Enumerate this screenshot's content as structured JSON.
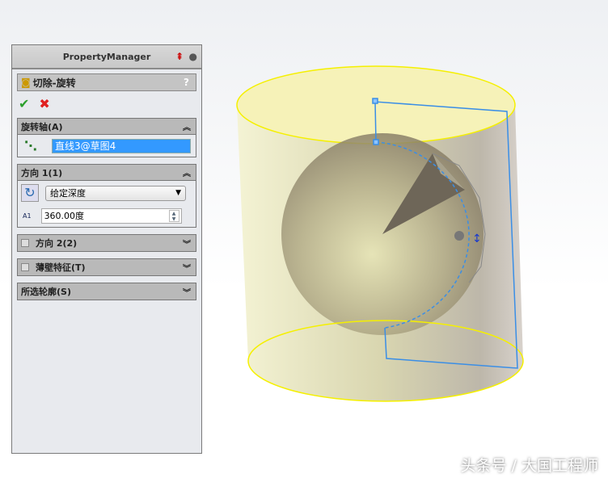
{
  "property_manager": {
    "title": "PropertyManager",
    "feature_name": "切除-旋转",
    "help": "?",
    "ok": "✔",
    "cancel": "✖",
    "axis_group": {
      "title": "旋转轴(A)",
      "value": "直线3@草图4"
    },
    "direction1": {
      "title": "方向 1(1)",
      "end_condition": "给定深度",
      "angle": "360.00度",
      "angle_icon_label": "A1"
    },
    "direction2": {
      "title": "方向 2(2)",
      "checked": false
    },
    "thin": {
      "title": "薄壁特征(T)",
      "checked": false
    },
    "contours": {
      "title": "所选轮廓(S)"
    }
  },
  "watermark": "头条号 / 大国工程师",
  "colors": {
    "sketch": "#3a8ee6",
    "edge": "#f5f000",
    "body": "#d8d6b0"
  }
}
